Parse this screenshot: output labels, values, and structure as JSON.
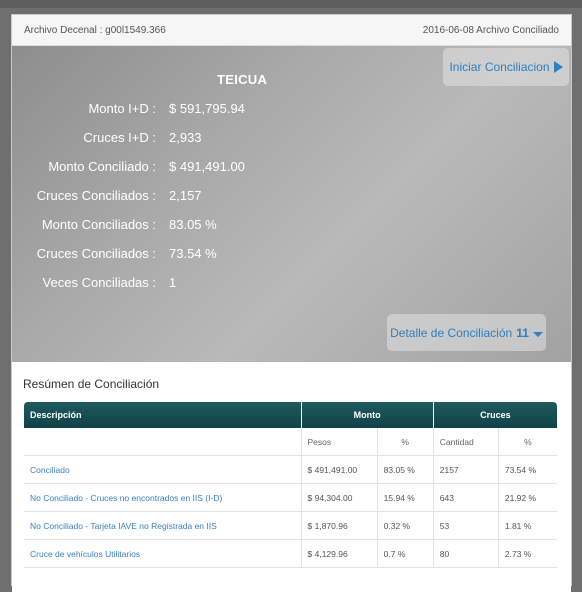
{
  "header": {
    "archivo_label": "Archivo Decenal : g00l1549.366",
    "status": "2016-06-08 Archivo Conciliado"
  },
  "hero": {
    "title": "TEICUA",
    "start_button": "Iniciar Conciliacion",
    "detail_button": "Detalle de Conciliación",
    "detail_count": "11",
    "stats": [
      {
        "label": "Monto I+D :",
        "value": "$ 591,795.94"
      },
      {
        "label": "Cruces I+D :",
        "value": "2,933"
      },
      {
        "label": "Monto Conciliado :",
        "value": "$ 491,491.00"
      },
      {
        "label": "Cruces Conciliados :",
        "value": "2,157"
      },
      {
        "label": "Monto Conciliados :",
        "value": "83.05 %"
      },
      {
        "label": "Cruces Conciliados :",
        "value": "73.54 %"
      },
      {
        "label": "Veces Conciliadas :",
        "value": "1"
      }
    ]
  },
  "summary": {
    "title": "Resúmen de Conciliación",
    "headers": {
      "descripcion": "Descripción",
      "monto": "Monto",
      "cruces": "Cruces"
    },
    "subheaders": {
      "pesos": "Pesos",
      "pct": "%",
      "cantidad": "Cantidad",
      "pct2": "%"
    },
    "rows": [
      {
        "desc": "Conciliado",
        "pesos": "$ 491,491.00",
        "pct_monto": "83.05 %",
        "cantidad": "2157",
        "pct_cruces": "73.54 %"
      },
      {
        "desc": "No Conciliado - Cruces no encontrados en IIS (I-D)",
        "pesos": "$ 94,304.00",
        "pct_monto": "15.94 %",
        "cantidad": "643",
        "pct_cruces": "21.92 %"
      },
      {
        "desc": "No Conciliado - Tarjeta IAVE no Registrada en IIS",
        "pesos": "$ 1,870.96",
        "pct_monto": "0.32 %",
        "cantidad": "53",
        "pct_cruces": "1.81 %"
      },
      {
        "desc": "Cruce de vehículos Utilitarios",
        "pesos": "$ 4,129.96",
        "pct_monto": "0.7 %",
        "cantidad": "80",
        "pct_cruces": "2.73 %"
      }
    ]
  }
}
